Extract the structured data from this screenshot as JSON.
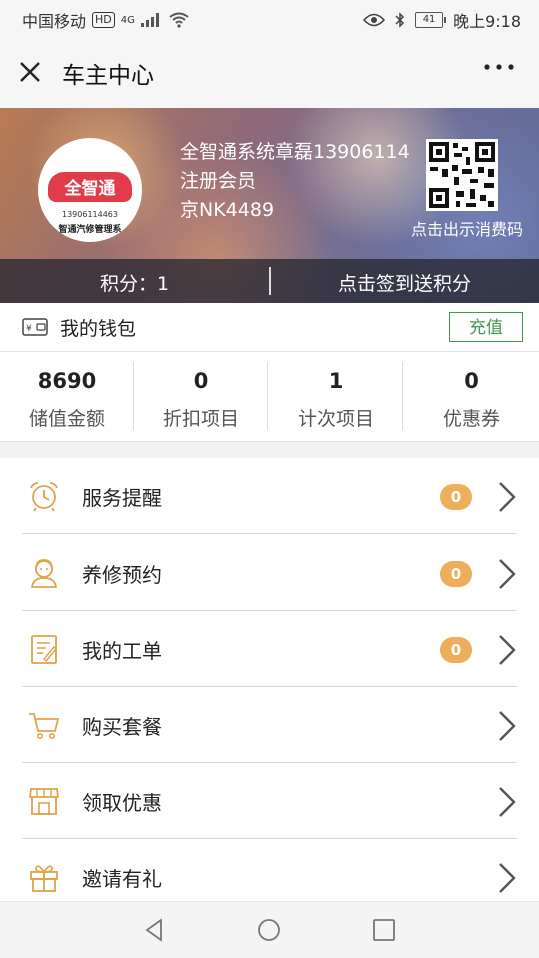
{
  "status_bar": {
    "carrier": "中国移动",
    "hd": "HD",
    "network": "4G",
    "battery": "41",
    "time": "晚上9:18"
  },
  "header": {
    "title": "车主中心",
    "close_icon": "close-icon",
    "more_icon": "more-dots-icon"
  },
  "profile": {
    "name": "全智通系统章磊13906114",
    "member_level": "注册会员",
    "plate": "京NK4489",
    "logo_text": "全智通",
    "logo_phone": "13906114463",
    "logo_subtitle": "智通汽修管理系",
    "qr_caption": "点击出示消费码"
  },
  "points": {
    "label": "积分：1",
    "checkin": "点击签到送积分"
  },
  "wallet": {
    "title": "我的钱包",
    "recharge_label": "充值",
    "stats": [
      {
        "value": "8690",
        "label": "储值金额"
      },
      {
        "value": "0",
        "label": "折扣项目"
      },
      {
        "value": "1",
        "label": "计次项目"
      },
      {
        "value": "0",
        "label": "优惠券"
      }
    ]
  },
  "menu": [
    {
      "label": "服务提醒",
      "icon": "alarm-clock-icon",
      "badge": "0"
    },
    {
      "label": "养修预约",
      "icon": "customer-service-icon",
      "badge": "0"
    },
    {
      "label": "我的工单",
      "icon": "work-order-icon",
      "badge": "0"
    },
    {
      "label": "购买套餐",
      "icon": "shopping-cart-icon"
    },
    {
      "label": "领取优惠",
      "icon": "store-icon"
    },
    {
      "label": "邀请有礼",
      "icon": "gift-icon"
    }
  ],
  "colors": {
    "accent_green": "#3d9a4c",
    "badge_orange": "#efae5b",
    "icon_orange": "#e2a14a"
  }
}
